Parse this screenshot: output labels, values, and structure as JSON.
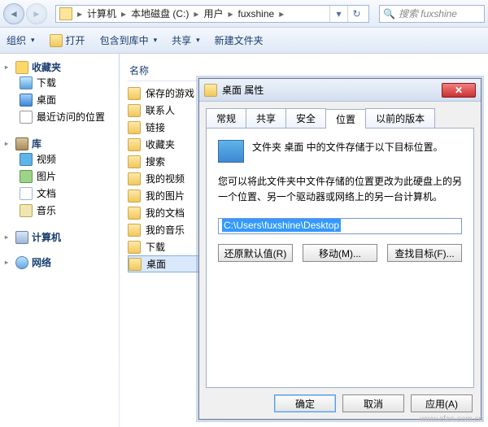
{
  "nav": {
    "crumbs": [
      "计算机",
      "本地磁盘 (C:)",
      "用户",
      "fuxshine"
    ],
    "searchPlaceholder": "搜索 fuxshine"
  },
  "toolbar": {
    "org": "组织",
    "open": "打开",
    "include": "包含到库中",
    "share": "共享",
    "newfold": "新建文件夹"
  },
  "sidebar": {
    "fav": {
      "label": "收藏夹",
      "items": [
        "下载",
        "桌面",
        "最近访问的位置"
      ]
    },
    "lib": {
      "label": "库",
      "items": [
        "视频",
        "图片",
        "文档",
        "音乐"
      ]
    },
    "comp": "计算机",
    "net": "网络"
  },
  "content": {
    "col": "名称",
    "items": [
      "保存的游戏",
      "联系人",
      "链接",
      "收藏夹",
      "搜索",
      "我的视频",
      "我的图片",
      "我的文档",
      "我的音乐",
      "下载",
      "桌面"
    ]
  },
  "dialog": {
    "title": "桌面 属性",
    "tabs": [
      "常规",
      "共享",
      "安全",
      "位置",
      "以前的版本"
    ],
    "activeTab": 3,
    "line1": "文件夹 桌面 中的文件存储于以下目标位置。",
    "line2": "您可以将此文件夹中文件存储的位置更改为此硬盘上的另一个位置、另一个驱动器或网络上的另一台计算机。",
    "path": "C:\\Users\\fuxshine\\Desktop",
    "btns": {
      "restore": "还原默认值(R)",
      "move": "移动(M)...",
      "find": "查找目标(F)..."
    },
    "ok": "确定",
    "cancel": "取消",
    "apply": "应用(A)"
  },
  "watermark": "www.cfan.com.cn"
}
